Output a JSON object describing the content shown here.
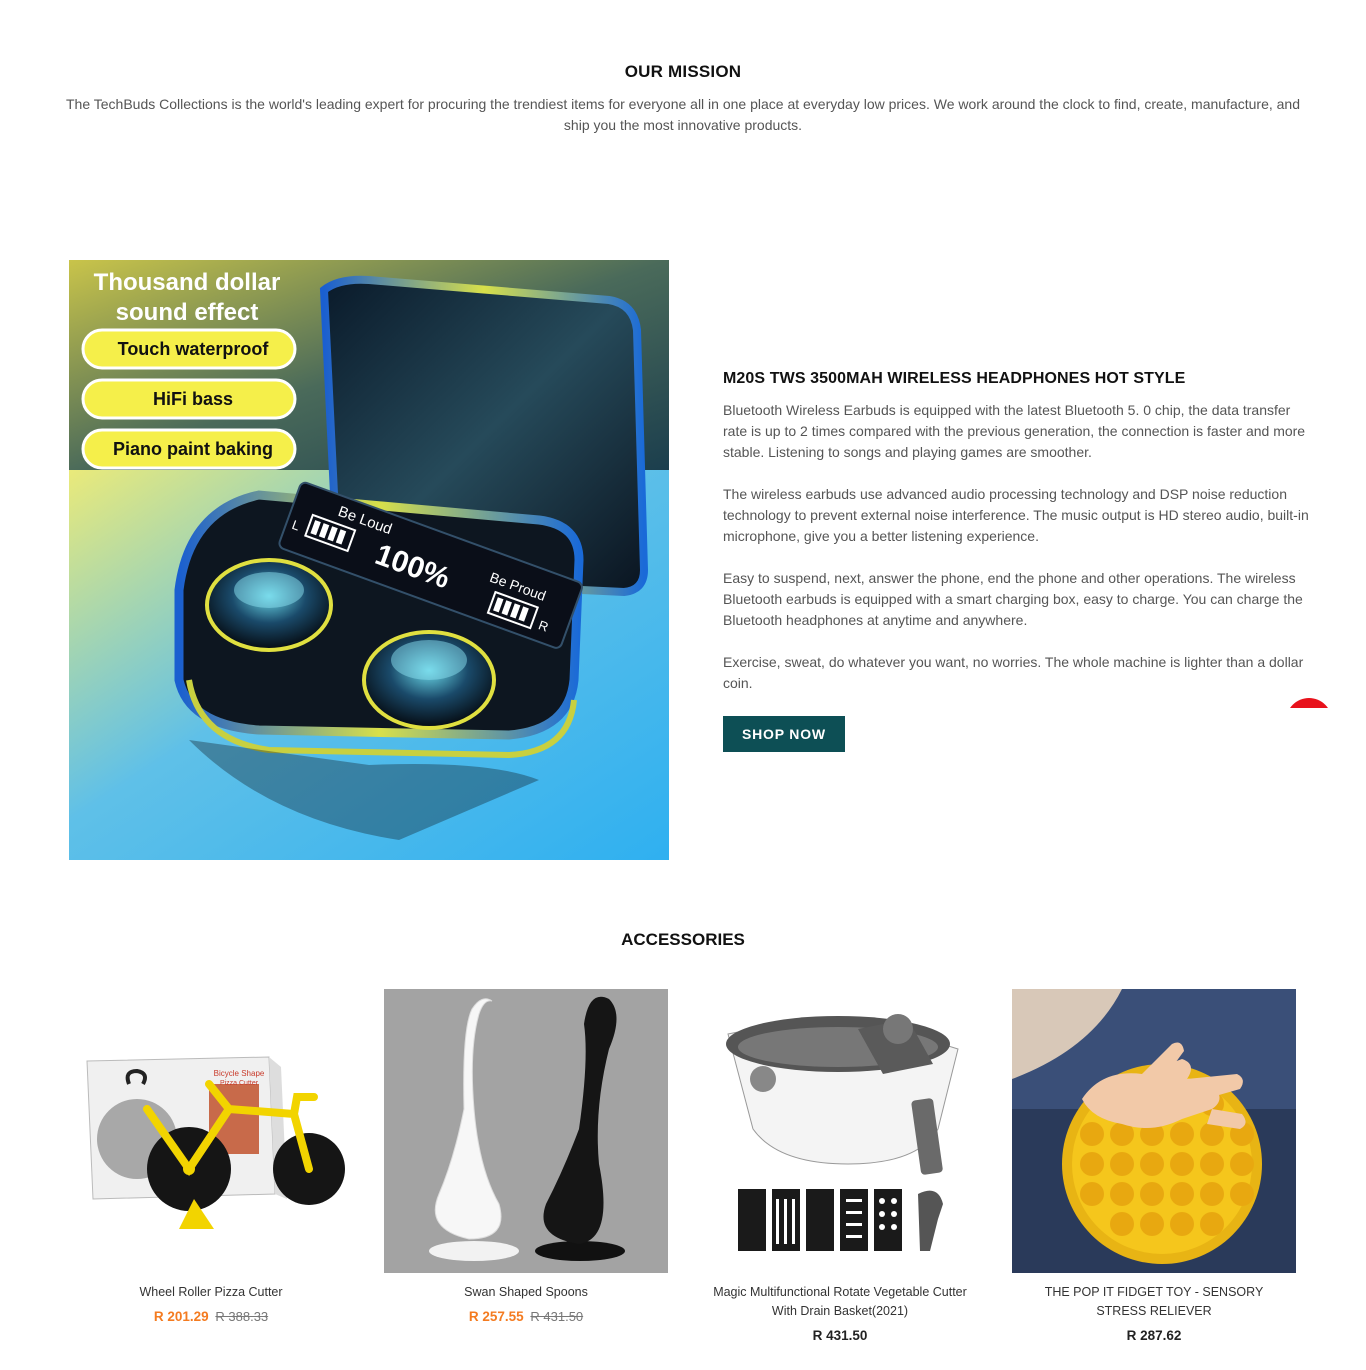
{
  "mission": {
    "title": "OUR MISSION",
    "text": "The TechBuds Collections is the world's leading expert for procuring the trendiest items for everyone all in one place at everyday low prices. We work around the clock to find, create, manufacture, and ship you the most innovative products."
  },
  "feature": {
    "image": {
      "headline_line1": "Thousand dollar",
      "headline_line2": "sound effect",
      "pill1": "Touch waterproof",
      "pill2": "HiFi bass",
      "pill3": "Piano paint baking",
      "lcd_be_loud": "Be  Loud",
      "lcd_be_proud": "Be  Proud",
      "lcd_percent": "100%",
      "lcd_l": "L",
      "lcd_r": "R"
    },
    "title": "M20S TWS 3500MAH WIRELESS HEADPHONES HOT STYLE",
    "paragraphs": [
      "Bluetooth Wireless Earbuds is equipped with the latest Bluetooth 5. 0 chip, the data transfer rate is up to 2 times compared with the previous generation, the connection is faster and more stable. Listening to songs and playing games are smoother.",
      "The wireless earbuds use advanced audio processing technology and DSP noise reduction technology to prevent external noise interference. The music output is HD stereo audio, built-in microphone, give you a better listening experience.",
      "Easy to suspend, next, answer the phone, end the phone and other operations. The wireless Bluetooth earbuds is equipped with a smart charging box, easy to charge. You can charge the Bluetooth headphones at anytime and anywhere.",
      "Exercise, sweat, do whatever you want, no worries. The whole machine is lighter than a dollar coin."
    ],
    "button": "SHOP NOW"
  },
  "accessories": {
    "title": "ACCESSORIES",
    "products": [
      {
        "name": "Wheel Roller Pizza Cutter",
        "sale_price": "R 201.29",
        "old_price": "R 388.33",
        "box_text_1": "Bicycle Shape",
        "box_text_2": "Pizza Cutter"
      },
      {
        "name": "Swan Shaped Spoons",
        "sale_price": "R 257.55",
        "old_price": "R 431.50"
      },
      {
        "name": "Magic Multifunctional Rotate Vegetable Cutter With Drain Basket(2021)",
        "price": "R 431.50"
      },
      {
        "name": "THE POP IT FIDGET TOY - SENSORY STRESS RELIEVER",
        "price": "R 287.62"
      }
    ]
  },
  "colors": {
    "button_bg": "#0d4f55",
    "sale_price": "#f47b20",
    "chat_bubble": "#e8121c"
  },
  "icons": [
    "chat-bubble-icon"
  ]
}
